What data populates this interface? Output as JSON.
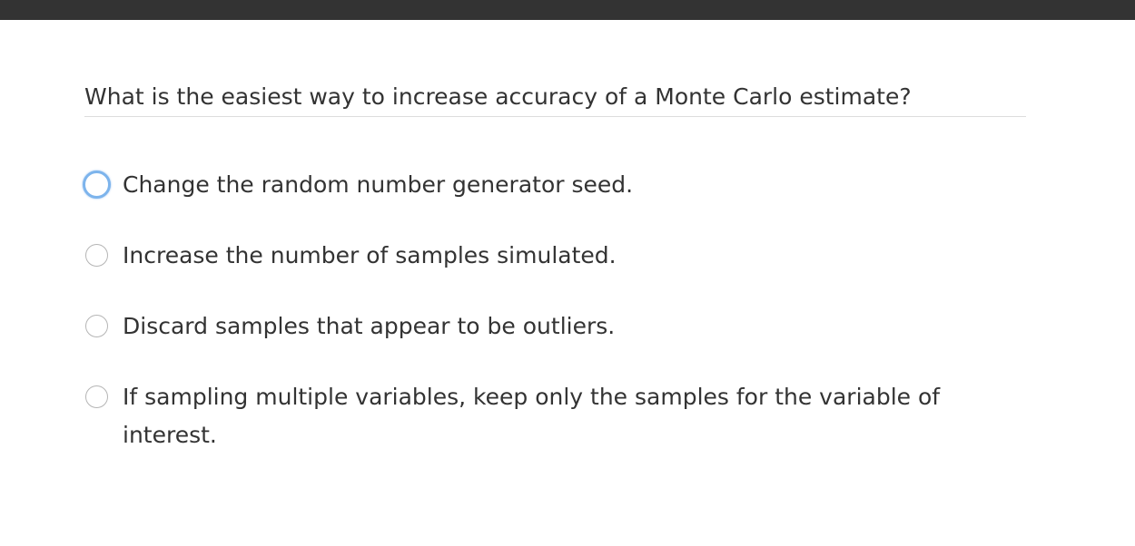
{
  "question": {
    "title": "What is the easiest way to increase accuracy of a Monte Carlo estimate?"
  },
  "options": [
    {
      "label": "Change the random number generator seed.",
      "focused": true
    },
    {
      "label": "Increase the number of samples simulated.",
      "focused": false
    },
    {
      "label": "Discard samples that appear to be outliers.",
      "focused": false
    },
    {
      "label": "If sampling multiple variables, keep only the samples for the variable of interest.",
      "focused": false
    }
  ],
  "colors": {
    "top_bar": "#333333",
    "focus_ring": "#7db4ec",
    "text": "#333333"
  }
}
